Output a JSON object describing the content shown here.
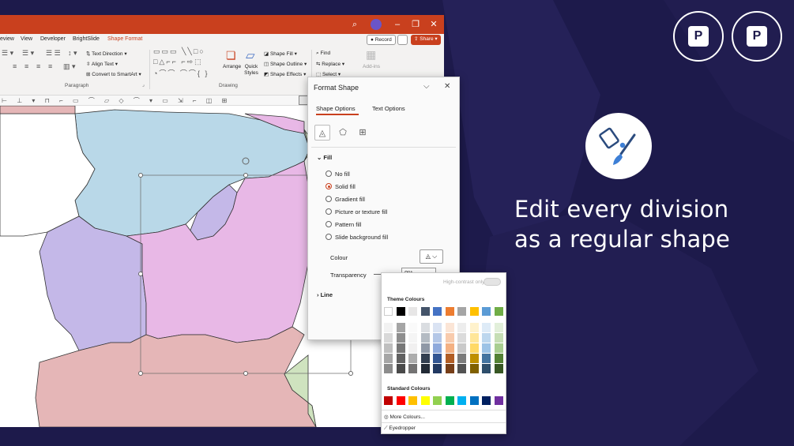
{
  "menu": {
    "items": [
      "eview",
      "Developer",
      "BrightSlide",
      "Shape Format"
    ],
    "record_label": "Record",
    "share_label": "Share"
  },
  "ribbon": {
    "text_direction": "Text Direction",
    "align_text": "Align Text",
    "convert_smartart": "Convert to SmartArt",
    "paragraph_group": "Paragraph",
    "drawing_group": "Drawing",
    "arrange": "Arrange",
    "quick_styles": "Quick Styles",
    "shape_fill": "Shape Fill",
    "shape_outline": "Shape Outline",
    "shape_effects": "Shape Effects",
    "find": "Find",
    "replace": "Replace",
    "select": "Select",
    "add_ins": "Add-ins"
  },
  "format_pane": {
    "title": "Format Shape",
    "tabs": [
      "Shape Options",
      "Text Options"
    ],
    "fill_section": "Fill",
    "fill_options": [
      "No fill",
      "Solid fill",
      "Gradient fill",
      "Picture or texture fill",
      "Pattern fill",
      "Slide background fill"
    ],
    "selected_fill": "Solid fill",
    "colour_label": "Colour",
    "transparency_label": "Transparency",
    "transparency_value": "0%",
    "line_section": "Line"
  },
  "palette": {
    "high_contrast_label": "High-contrast only",
    "theme_label": "Theme Colours",
    "standard_label": "Standard Colours",
    "more_colours": "More Colours...",
    "eyedropper": "Eyedropper",
    "theme_row": [
      "#ffffff",
      "#000000",
      "#e7e6e6",
      "#44546a",
      "#4472c4",
      "#ed7d31",
      "#a5a5a5",
      "#ffc000",
      "#5b9bd5",
      "#70ad47"
    ],
    "standard_row": [
      "#c00000",
      "#ff0000",
      "#ffc000",
      "#ffff00",
      "#92d050",
      "#00b050",
      "#00b0f0",
      "#0070c0",
      "#002060",
      "#7030a0"
    ]
  },
  "promo": {
    "headline_line1": "Edit every division",
    "headline_line2": "as a regular shape",
    "badge1_text": "PPTMAN.COM · PPTMAN.COM ·",
    "badge2_text": "100 % · POWERPOINT · EDITABLE ·"
  },
  "colors": {
    "accent": "#c9401e",
    "background": "#1d1a4b",
    "region_blue": "#b9d8e8",
    "region_pink": "#e8b8e6",
    "region_lavender": "#c4b8e8",
    "region_rose": "#e5b6b7",
    "region_green": "#cfe3bf"
  },
  "icons": [
    "fill-bucket-icon",
    "pentagon-icon",
    "size-icon",
    "search-icon",
    "eyedropper-icon"
  ]
}
